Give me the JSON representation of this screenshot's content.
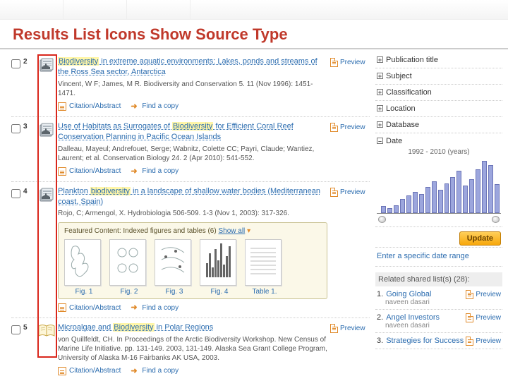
{
  "slide_title": "Results List Icons Show Source Type",
  "labels": {
    "preview": "Preview",
    "citation": "Citation/Abstract",
    "find": "Find a copy",
    "featured_prefix": "Featured Content: Indexed figures and tables (6) ",
    "show_all": "Show all",
    "update": "Update",
    "specific_date": "Enter a specific date range",
    "related_head": "Related shared list(s) (28):",
    "date_range": "1992 - 2010 (years)"
  },
  "results": [
    {
      "num": "2",
      "title_pre": "",
      "hl": "Biodiversity",
      "title_post": " in extreme aquatic environments: Lakes, ponds and streams of the Ross Sea sector, Antarctica",
      "meta": "Vincent, W F; James, M R. Biodiversity and Conservation 5. 11 (Nov 1996): 1451-1471.",
      "icon": "journal"
    },
    {
      "num": "3",
      "title_pre": "Use of Habitats as Surrogates of ",
      "hl": "Biodiversity",
      "title_post": " for Efficient Coral Reef Conservation Planning in Pacific Ocean Islands",
      "meta": "Dalleau, Mayeul; Andrefouet, Serge; Wabnitz, Colette CC; Payri, Claude; Wantiez, Laurent; et al. Conservation Biology 24. 2 (Apr 2010): 541-552.",
      "icon": "journal"
    },
    {
      "num": "4",
      "title_pre": "Plankton ",
      "hl": "biodiversity",
      "title_post": " in a landscape of shallow water bodies (Mediterranean coast, Spain)",
      "meta": "Rojo, C; Armengol, X. Hydrobiologia 506-509. 1-3 (Nov 1, 2003): 317-326.",
      "icon": "journal"
    },
    {
      "num": "5",
      "title_pre": "Microalgae and ",
      "hl": "Biodiversity",
      "title_post": " in Polar Regions",
      "meta": "von Quillfeldt, CH. In Proceedings of the Arctic Biodiversity Workshop. New Census of Marine Life Initiative. pp. 131-149. 2003, 131-149. Alaska Sea Grant College Program, University of Alaska M-16 Fairbanks AK USA, 2003.",
      "icon": "book"
    }
  ],
  "thumbs": [
    {
      "cap": "Fig. 1"
    },
    {
      "cap": "Fig. 2"
    },
    {
      "cap": "Fig. 3"
    },
    {
      "cap": "Fig. 4"
    },
    {
      "cap": "Table 1."
    }
  ],
  "facets": [
    "Publication title",
    "Subject",
    "Classification",
    "Location",
    "Database",
    "Date"
  ],
  "chart_data": {
    "type": "bar",
    "title": "Date",
    "xlabel": "years",
    "ylabel": "count",
    "x_range": [
      1992,
      2010
    ],
    "categories_note": "Yearly bins 1992–2010",
    "values": [
      5,
      3,
      6,
      14,
      18,
      22,
      20,
      28,
      35,
      25,
      33,
      40,
      48,
      30,
      38,
      50,
      60,
      55,
      32
    ]
  },
  "related": [
    {
      "n": "1.",
      "title": "Going Global",
      "author": "naveen dasari"
    },
    {
      "n": "2.",
      "title": "Angel Investors",
      "author": "naveen dasari"
    },
    {
      "n": "3.",
      "title": "Strategies for Success",
      "author": ""
    }
  ]
}
